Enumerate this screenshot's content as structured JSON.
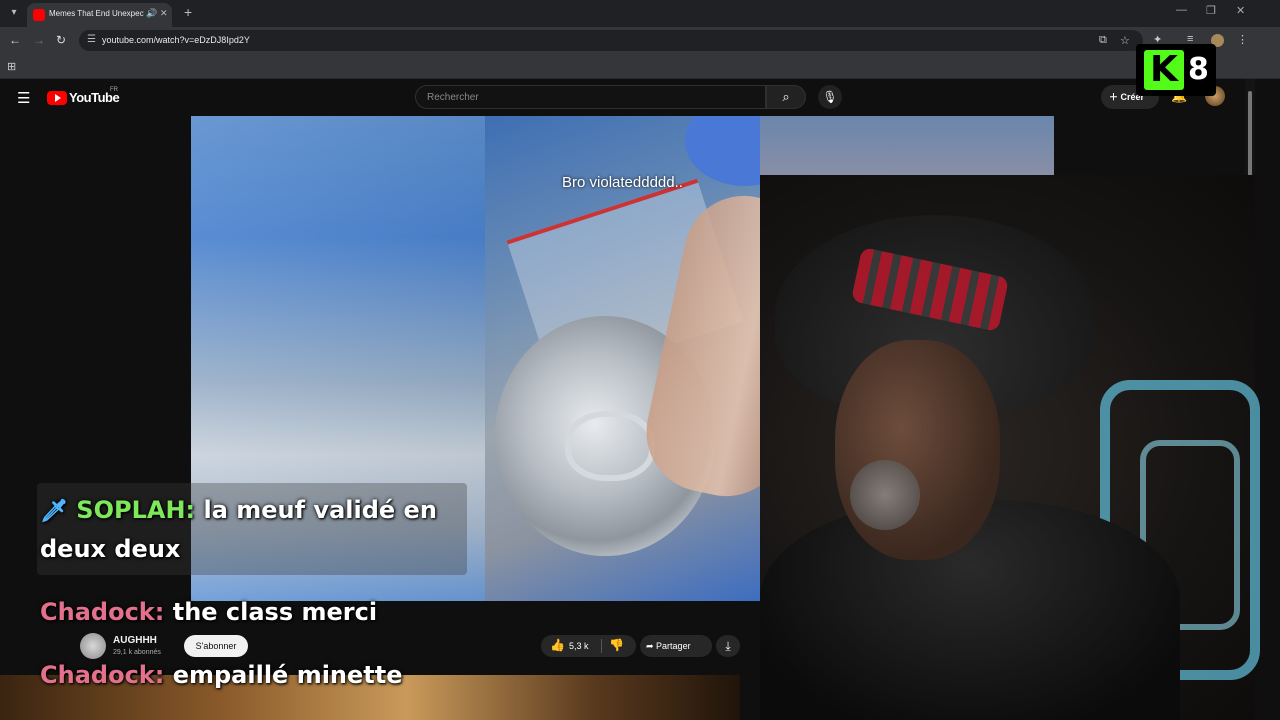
{
  "browser": {
    "tab_title": "Memes That End Unexpecte",
    "url": "youtube.com/watch?v=eDzDJ8Ipd2Y",
    "icons": [
      "tab-menu-icon",
      "audio-icon",
      "close-icon",
      "new-tab-icon",
      "back-icon",
      "forward-icon",
      "reload-icon",
      "site-info-icon",
      "install-icon",
      "star-icon",
      "extensions-icon",
      "media-icon",
      "profile-icon",
      "menu-icon",
      "apps-icon"
    ]
  },
  "youtube": {
    "logo_text": "YouTube",
    "region": "FR",
    "search_placeholder": "Rechercher",
    "create_label": "Créer",
    "video": {
      "caption": "Bro violateddddd..",
      "channel_name": "AUGHHH",
      "channel_subs": "29,1 k abonnés",
      "subscribe_label": "S'abonner",
      "likes": "5,3 k",
      "share_label": "Partager"
    }
  },
  "chat": [
    {
      "user": "SOPLAH:",
      "message": "la meuf validé en",
      "message_cont": "deux deux",
      "color": "#7ee85a"
    },
    {
      "user": "Chadock:",
      "message": "the class merci",
      "color": "#e3708d"
    },
    {
      "user": "Chadock:",
      "message": "empaillé minette",
      "color": "#e3708d"
    }
  ],
  "kick_badge": {
    "number": "8",
    "accent": "#53fc18"
  },
  "colors": {
    "yt_red": "#ff0000",
    "background": "#0f0f0f"
  }
}
